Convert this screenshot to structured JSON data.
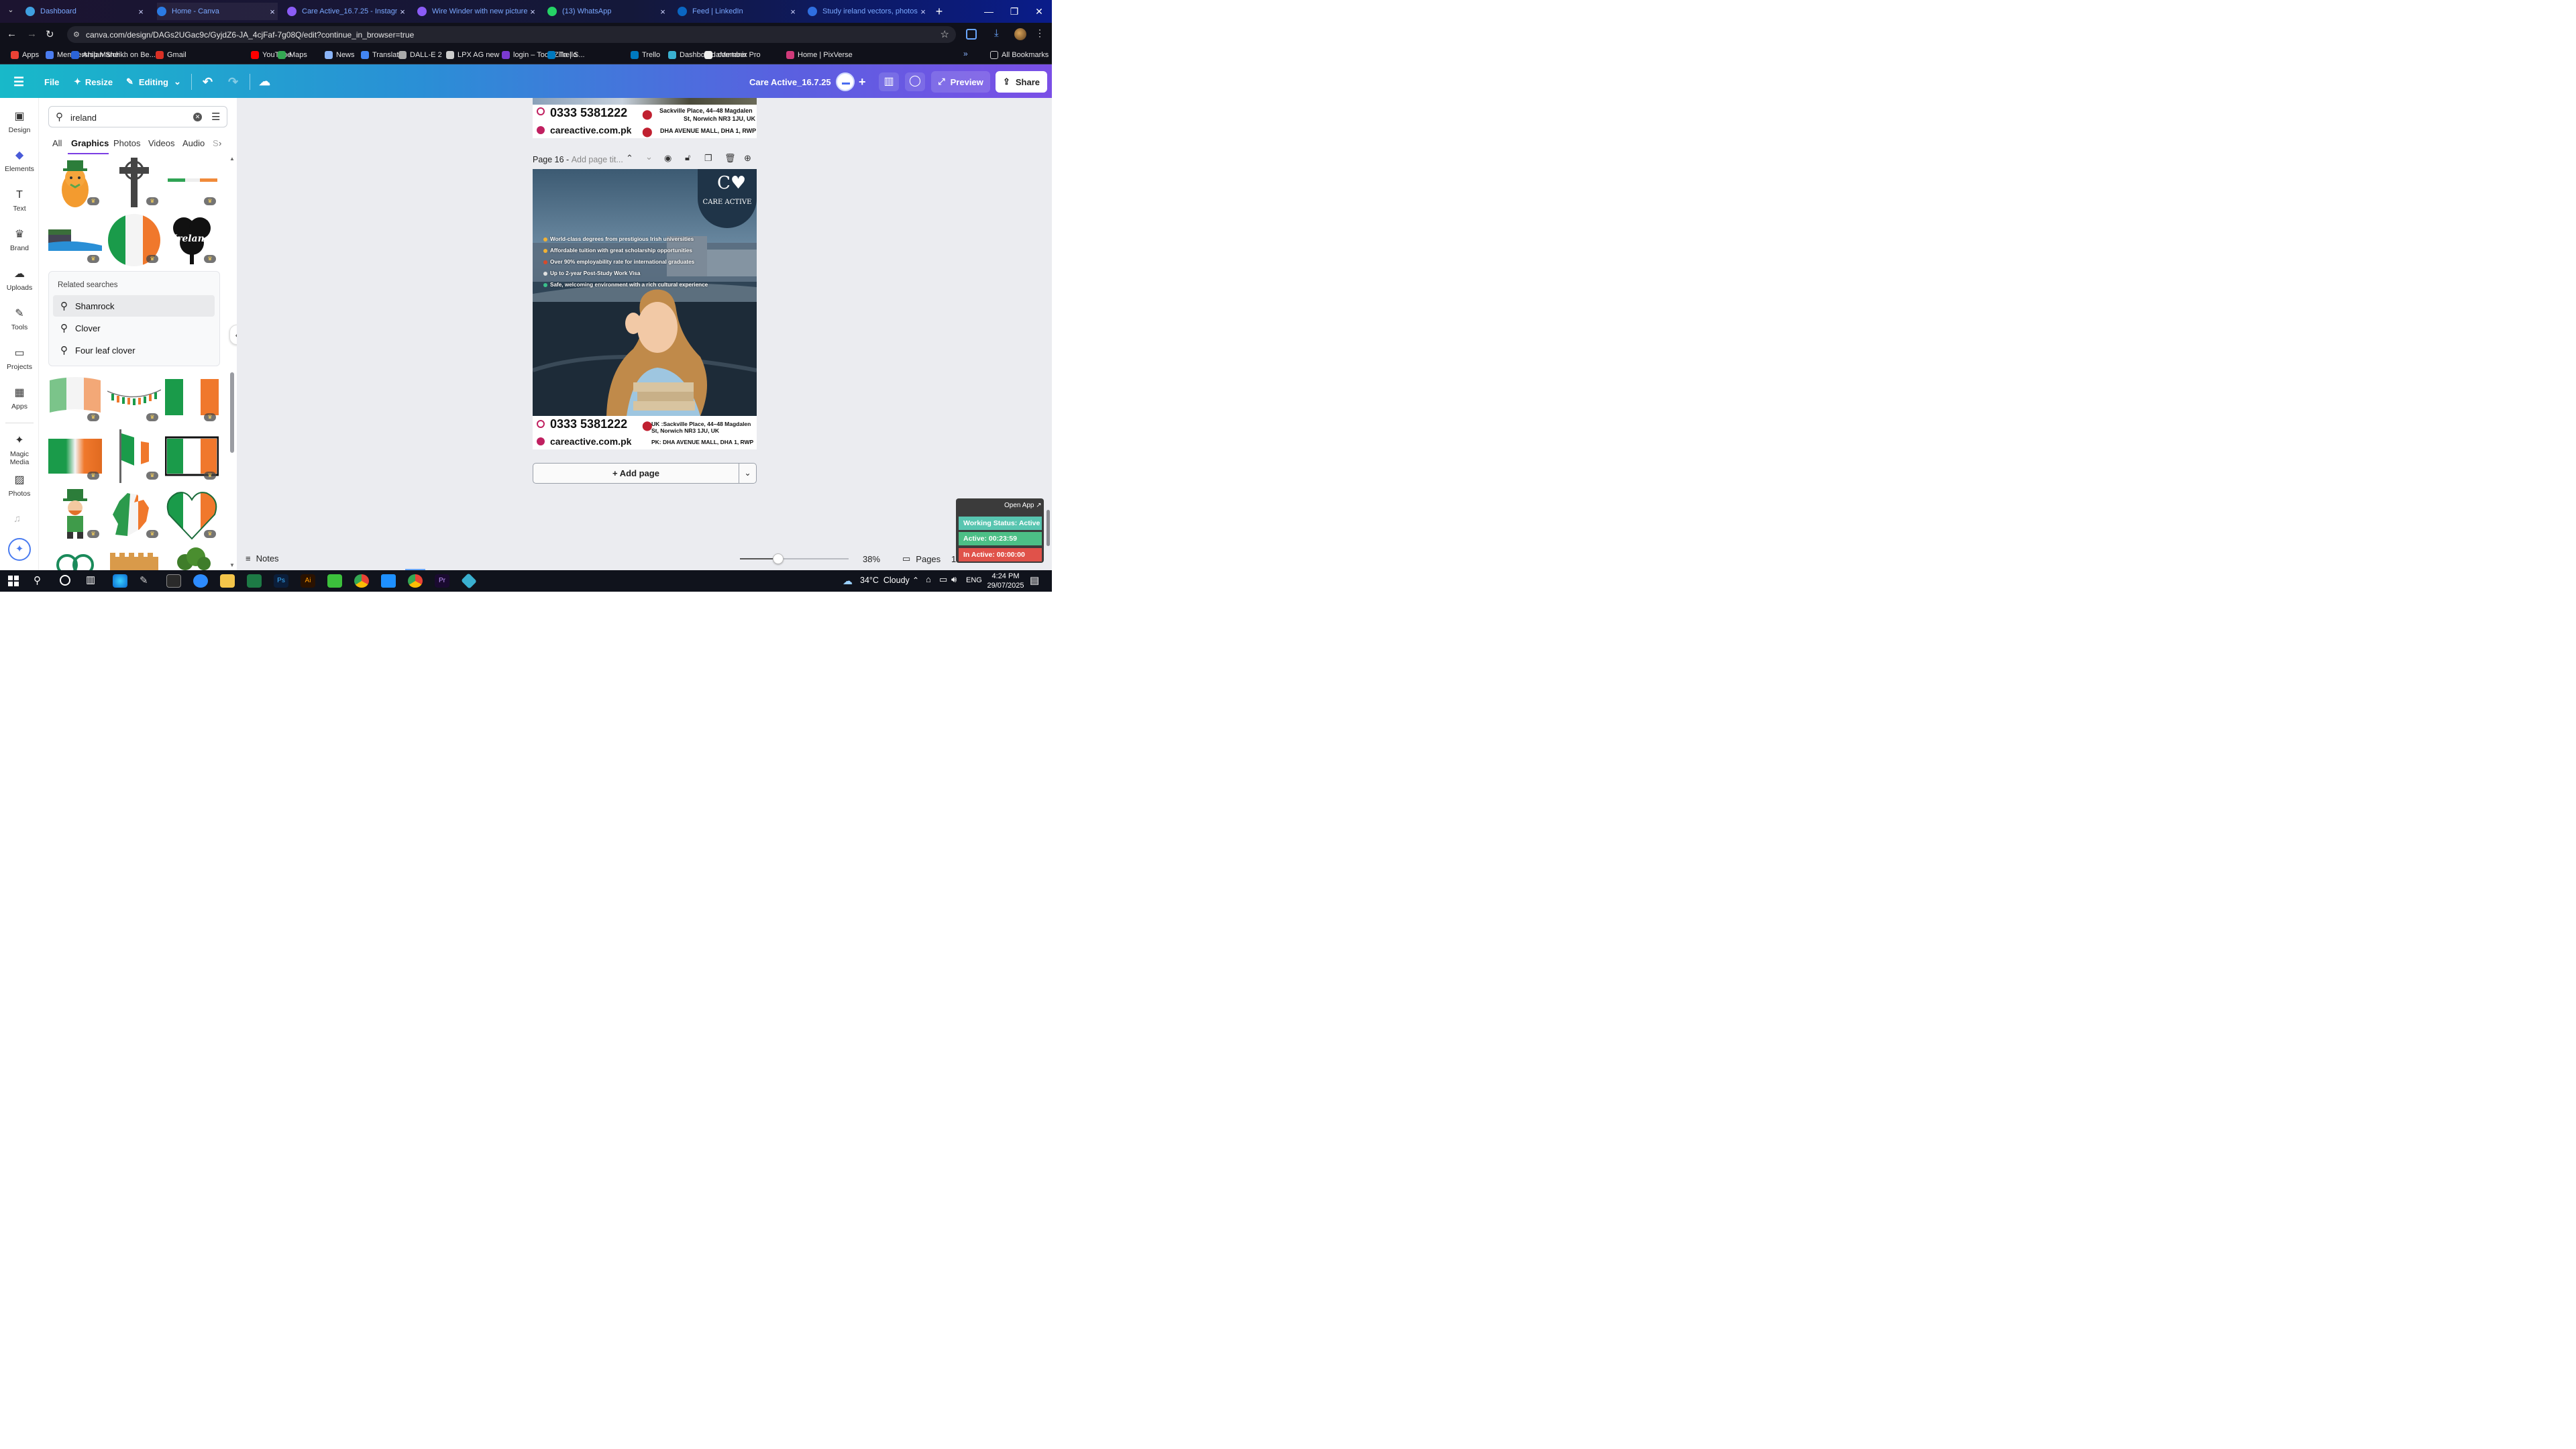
{
  "browser": {
    "tabs": [
      {
        "title": "Dashboard",
        "color": "#3fa0e0"
      },
      {
        "title": "Home - Canva",
        "color": "#2b7be4"
      },
      {
        "title": "Care Active_16.7.25 - Instagram",
        "color": "#8b5cf6"
      },
      {
        "title": "Wire Winder with new pictures",
        "color": "#8b5cf6"
      },
      {
        "title": "(13) WhatsApp",
        "color": "#25d366"
      },
      {
        "title": "Feed | LinkedIn",
        "color": "#0a66c2"
      },
      {
        "title": "Study ireland vectors, photos a",
        "color": "#2f6fe0"
      }
    ],
    "url": "canva.com/design/DAGs2UGac9c/GyjdZ6-JA_4cjFaf-7g08Q/edit?continue_in_browser=true",
    "bookmarks": [
      "Apps",
      "Membership March...",
      "Arslan Sheikh on Be...",
      "Gmail",
      "YouTube",
      "Maps",
      "News",
      "Translate",
      "DALL-E 2",
      "LPX AG new",
      "login – ToolsZilla | S...",
      "Trello",
      "Trello",
      "Dashboard comtanix",
      "aMember Pro",
      "Home | PixVerse"
    ],
    "all_bookmarks": "All Bookmarks"
  },
  "canva_header": {
    "file": "File",
    "resize": "Resize",
    "editing": "Editing",
    "doc_title": "Care Active_16.7.25",
    "preview": "Preview",
    "share": "Share"
  },
  "rail": [
    {
      "label": "Design",
      "icon": "design-icon",
      "glyph": "▣"
    },
    {
      "label": "Elements",
      "icon": "elements-icon",
      "glyph": "◆"
    },
    {
      "label": "Text",
      "icon": "text-icon",
      "glyph": "T"
    },
    {
      "label": "Brand",
      "icon": "brand-icon",
      "glyph": "♛"
    },
    {
      "label": "Uploads",
      "icon": "uploads-icon",
      "glyph": "☁"
    },
    {
      "label": "Tools",
      "icon": "tools-icon",
      "glyph": "✎"
    },
    {
      "label": "Projects",
      "icon": "projects-icon",
      "glyph": "▭"
    },
    {
      "label": "Apps",
      "icon": "apps-icon",
      "glyph": "▦"
    },
    {
      "label": "Magic Media",
      "icon": "magic-media-icon",
      "glyph": "✦"
    },
    {
      "label": "Photos",
      "icon": "photos-icon",
      "glyph": "▨"
    }
  ],
  "panel": {
    "search_value": "ireland",
    "tabs": [
      "All",
      "Graphics",
      "Photos",
      "Videos",
      "Audio",
      "S"
    ],
    "active_tab": "Graphics",
    "related_title": "Related searches",
    "related": [
      "Shamrock",
      "Clover",
      "Four leaf clover"
    ]
  },
  "page_prev": {
    "phone": "0333 5381222",
    "site": "careactive.com.pk",
    "addr1": "Sackville Place, 44–48 Magdalen",
    "addr2": "St, Norwich NR3 1JU, UK",
    "addr3": "DHA AVENUE MALL, DHA 1, RWP"
  },
  "page16": {
    "label": "Page 16 - ",
    "title_placeholder": "Add page tit...",
    "brand": "CARE ACTIVE",
    "bullets": [
      "World-class degrees from prestigious Irish universities",
      "Affordable tuition with great scholarship opportunities",
      "Over 90% employability rate for international graduates",
      "Up to 2-year Post-Study Work Visa",
      "Safe, welcoming environment with a rich cultural experience"
    ],
    "phone": "0333 5381222",
    "site": "careactive.com.pk",
    "addr1": "UK :Sackville Place, 44–48 Magdalen",
    "addr2": "St, Norwich NR3 1JU, UK",
    "addr3": "PK: DHA AVENUE MALL, DHA 1, RWP"
  },
  "add_page": "+ Add page",
  "bottom": {
    "notes": "Notes",
    "zoom": "38%",
    "zoom_fraction": 0.38,
    "pages": "Pages",
    "page_count": "16 / 16"
  },
  "widget": {
    "open_app": "Open App ↗",
    "working": "Working Status: Active",
    "active": "Active: 00:23:59",
    "inactive": "In Active: 00:00:00"
  },
  "taskbar": {
    "weather": "34°C  Cloudy",
    "lang": "ENG",
    "time": "4:24 PM",
    "date": "29/07/2025"
  }
}
